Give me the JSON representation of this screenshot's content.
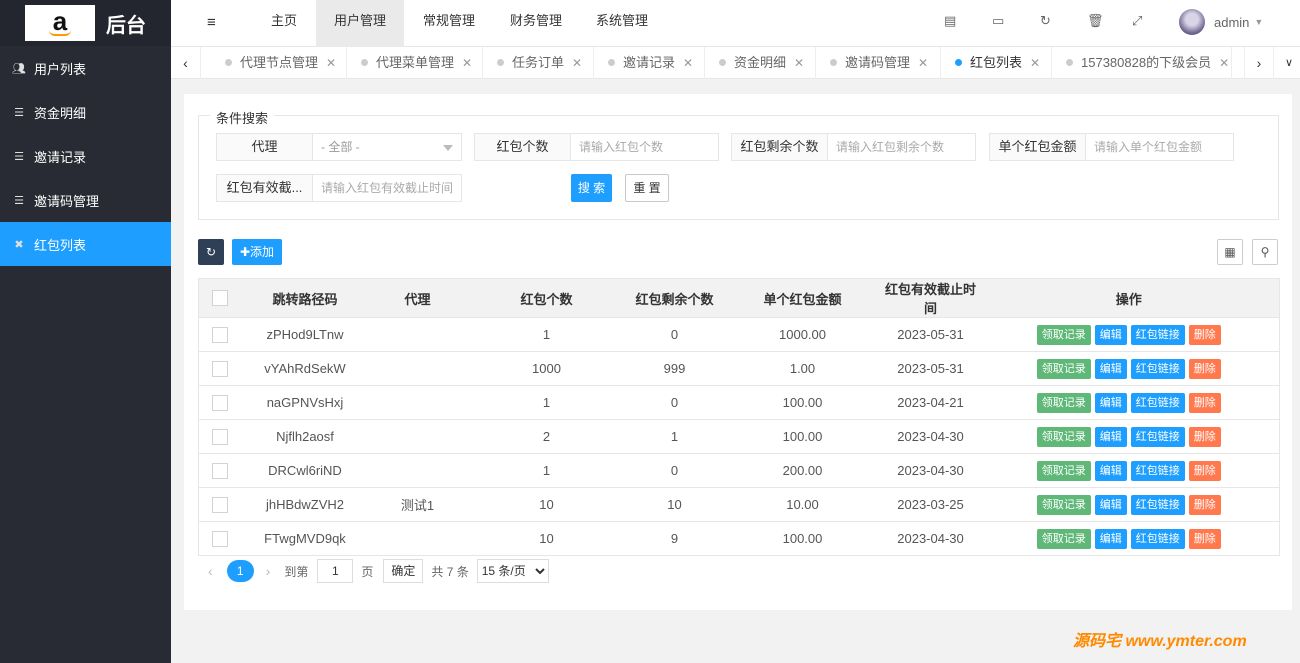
{
  "app": {
    "title": "后台"
  },
  "sidebar": {
    "items": [
      {
        "label": "用户列表",
        "icon": "users-icon"
      },
      {
        "label": "资金明细",
        "icon": "list-icon"
      },
      {
        "label": "邀请记录",
        "icon": "list-icon"
      },
      {
        "label": "邀请码管理",
        "icon": "list-icon"
      },
      {
        "label": "红包列表",
        "icon": "redpacket-icon",
        "active": true
      }
    ]
  },
  "topnav": {
    "items": [
      "主页",
      "用户管理",
      "常规管理",
      "财务管理",
      "系统管理"
    ],
    "active": "用户管理",
    "user": "admin"
  },
  "tabs": [
    {
      "label": "代理节点管理"
    },
    {
      "label": "代理菜单管理"
    },
    {
      "label": "任务订单"
    },
    {
      "label": "邀请记录"
    },
    {
      "label": "资金明细"
    },
    {
      "label": "邀请码管理"
    },
    {
      "label": "红包列表",
      "active": true
    },
    {
      "label": "157380828的下级会员"
    }
  ],
  "search": {
    "legend": "条件搜索",
    "fields": [
      {
        "label": "代理",
        "value": "- 全部 -"
      },
      {
        "label": "红包个数",
        "placeholder": "请输入红包个数"
      },
      {
        "label": "红包剩余个数",
        "placeholder": "请输入红包剩余个数"
      },
      {
        "label": "单个红包金额",
        "placeholder": "请输入单个红包金额"
      },
      {
        "label": "红包有效截...",
        "placeholder": "请输入红包有效截止时间"
      }
    ],
    "search_label": "搜 索",
    "reset_label": "重 置"
  },
  "toolbar": {
    "add_label": "添加"
  },
  "table": {
    "columns": [
      "跳转路径码",
      "代理",
      "红包个数",
      "红包剩余个数",
      "单个红包金额",
      "红包有效截止时间",
      "操作"
    ],
    "rows": [
      [
        "zPHod9LTnw",
        "",
        "1",
        "0",
        "1000.00",
        "2023-05-31"
      ],
      [
        "vYAhRdSekW",
        "",
        "1000",
        "999",
        "1.00",
        "2023-05-31"
      ],
      [
        "naGPNVsHxj",
        "",
        "1",
        "0",
        "100.00",
        "2023-04-21"
      ],
      [
        "Njflh2aosf",
        "",
        "2",
        "1",
        "100.00",
        "2023-04-30"
      ],
      [
        "DRCwl6riND",
        "",
        "1",
        "0",
        "200.00",
        "2023-04-30"
      ],
      [
        "jhHBdwZVH2",
        "测试1",
        "10",
        "10",
        "10.00",
        "2023-03-25"
      ],
      [
        "FTwgMVD9qk",
        "",
        "10",
        "9",
        "100.00",
        "2023-04-30"
      ]
    ],
    "actions": [
      "领取记录",
      "编辑",
      "红包链接",
      "删除"
    ]
  },
  "pager": {
    "current": "1",
    "goto_prefix": "到第",
    "goto_value": "1",
    "goto_suffix": "页",
    "confirm": "确定",
    "total": "共 7 条",
    "page_size": "15 条/页"
  },
  "watermark": "源码宅 www.ymter.com"
}
